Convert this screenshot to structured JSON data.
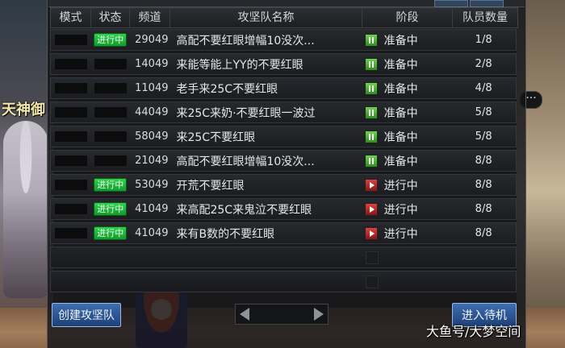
{
  "header": {
    "mode": "模式",
    "status": "状态",
    "channel": "频道",
    "name": "攻坚队名称",
    "stage": "阶段",
    "count": "队员数量"
  },
  "rows": [
    {
      "status": "进行中",
      "channel": "29049",
      "name": "高配不要红眼增幅10没次...",
      "stage": "准备中",
      "stage_icon": "pause-icon",
      "count": "1/8"
    },
    {
      "status": "",
      "channel": "14049",
      "name": "来能等能上YY的不要红眼",
      "stage": "准备中",
      "stage_icon": "pause-icon",
      "count": "2/8"
    },
    {
      "status": "",
      "channel": "11049",
      "name": "老手来25C不要红眼",
      "stage": "准备中",
      "stage_icon": "pause-icon",
      "count": "4/8"
    },
    {
      "status": "",
      "channel": "44049",
      "name": "来25C来奶·不要红眼一波过",
      "stage": "准备中",
      "stage_icon": "pause-icon",
      "count": "5/8"
    },
    {
      "status": "",
      "channel": "58049",
      "name": "来25C不要红眼",
      "stage": "准备中",
      "stage_icon": "pause-icon",
      "count": "5/8"
    },
    {
      "status": "",
      "channel": "21049",
      "name": "高配不要红眼增幅10没次...",
      "stage": "准备中",
      "stage_icon": "pause-icon",
      "count": "8/8"
    },
    {
      "status": "进行中",
      "channel": "53049",
      "name": "开荒不要红眼",
      "stage": "进行中",
      "stage_icon": "play-icon",
      "count": "8/8"
    },
    {
      "status": "进行中",
      "channel": "41049",
      "name": "来高配25C来鬼泣不要红眼",
      "stage": "进行中",
      "stage_icon": "play-icon",
      "count": "8/8"
    },
    {
      "status": "进行中",
      "channel": "41049",
      "name": "来有B数的不要红眼",
      "stage": "进行中",
      "stage_icon": "play-icon",
      "count": "8/8"
    }
  ],
  "empty_rows": 2,
  "buttons": {
    "create": "创建攻坚队",
    "enter": "进入待机"
  },
  "background": {
    "left_text": "天神御",
    "more": "···"
  },
  "watermark": "大鱼号/大梦空间",
  "colors": {
    "status_active": "#1fb53a",
    "stage_ready": "#3fae2a",
    "stage_running": "#c42222",
    "button_blue": "#2d5796"
  }
}
